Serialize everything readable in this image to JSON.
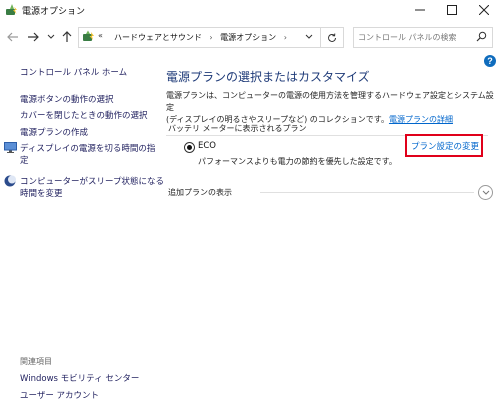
{
  "window": {
    "title": "電源オプション"
  },
  "address": {
    "prefix": "«",
    "crumbs": [
      "ハードウェアとサウンド",
      "電源オプション"
    ],
    "separator": "›"
  },
  "search": {
    "placeholder": "コントロール パネルの検索"
  },
  "help_label": "?",
  "sidebar": {
    "home": "コントロール パネル ホーム",
    "items": [
      {
        "label": "電源ボタンの動作の選択"
      },
      {
        "label": "カバーを閉じたときの動作の選択"
      },
      {
        "label": "電源プランの作成"
      },
      {
        "label": "ディスプレイの電源を切る時間の指",
        "label2": "定"
      },
      {
        "label": "コンピューターがスリープ状態になる",
        "label2": "時間を変更"
      }
    ],
    "related_heading": "関連項目",
    "related": [
      "Windows モビリティ センター",
      "ユーザー アカウント"
    ]
  },
  "main": {
    "heading": "電源プランの選択またはカスタマイズ",
    "description_line1": "電源プランは、コンピューターの電源の使用方法を管理するハードウェア設定とシステム設定",
    "description_line2": "(ディスプレイの明るさやスリープなど) のコレクションです。",
    "description_link": "電源プランの詳細",
    "battery_section": "バッテリ メーターに表示されるプラン",
    "plan": {
      "name": "ECO",
      "description": "パフォーマンスよりも電力の節約を優先した設定です。",
      "change_link": "プラン設定の変更",
      "selected": true
    },
    "more_plans": "追加プランの表示"
  },
  "colors": {
    "heading": "#1e3a78",
    "link": "#0066cc",
    "highlight": "#e0001a",
    "help": "#0f6cbd"
  }
}
